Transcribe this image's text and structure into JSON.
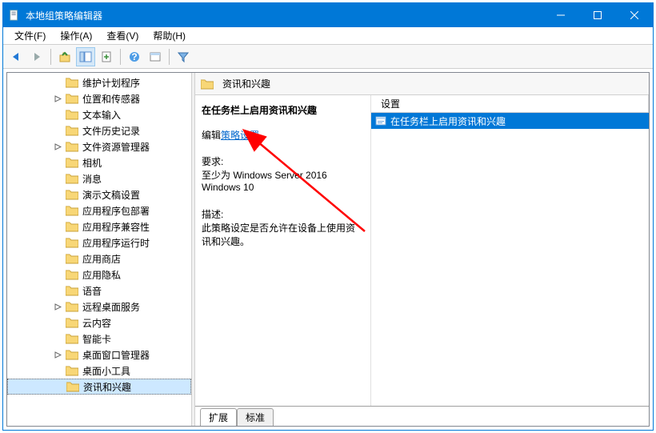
{
  "title": "本地组策略编辑器",
  "menus": {
    "file": "文件(F)",
    "action": "操作(A)",
    "view": "查看(V)",
    "help": "帮助(H)"
  },
  "tree_items": [
    {
      "label": "维护计划程序",
      "exp": false,
      "depth": 4
    },
    {
      "label": "位置和传感器",
      "exp": true,
      "depth": 4
    },
    {
      "label": "文本输入",
      "exp": false,
      "depth": 4
    },
    {
      "label": "文件历史记录",
      "exp": false,
      "depth": 4
    },
    {
      "label": "文件资源管理器",
      "exp": true,
      "depth": 4
    },
    {
      "label": "相机",
      "exp": false,
      "depth": 4
    },
    {
      "label": "消息",
      "exp": false,
      "depth": 4
    },
    {
      "label": "演示文稿设置",
      "exp": false,
      "depth": 4
    },
    {
      "label": "应用程序包部署",
      "exp": false,
      "depth": 4
    },
    {
      "label": "应用程序兼容性",
      "exp": false,
      "depth": 4
    },
    {
      "label": "应用程序运行时",
      "exp": false,
      "depth": 4
    },
    {
      "label": "应用商店",
      "exp": false,
      "depth": 4
    },
    {
      "label": "应用隐私",
      "exp": false,
      "depth": 4
    },
    {
      "label": "语音",
      "exp": false,
      "depth": 4
    },
    {
      "label": "远程桌面服务",
      "exp": true,
      "depth": 4
    },
    {
      "label": "云内容",
      "exp": false,
      "depth": 4
    },
    {
      "label": "智能卡",
      "exp": false,
      "depth": 4
    },
    {
      "label": "桌面窗口管理器",
      "exp": true,
      "depth": 4
    },
    {
      "label": "桌面小工具",
      "exp": false,
      "depth": 4
    },
    {
      "label": "资讯和兴趣",
      "exp": false,
      "depth": 4,
      "selected": true
    }
  ],
  "detail": {
    "header_label": "资讯和兴趣",
    "title": "在任务栏上启用资讯和兴趣",
    "edit_prefix": "编辑",
    "edit_link": "策略设置",
    "req_label": "要求:",
    "req_line1": "至少为 Windows Server 2016",
    "req_line2": "Windows 10",
    "desc_label": "描述:",
    "desc_text": "此策略设定是否允许在设备上使用资讯和兴趣。",
    "col_setting": "设置",
    "list_item": "在任务栏上启用资讯和兴趣",
    "tab_extended": "扩展",
    "tab_standard": "标准"
  }
}
